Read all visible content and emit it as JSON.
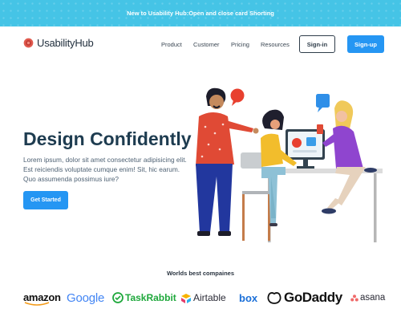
{
  "announcement": {
    "text": "New to Usability Hub:Open and close card Shorting"
  },
  "nav": {
    "brand": "UsabilityHub",
    "links": [
      "Product",
      "Customer",
      "Pricing",
      "Resources"
    ],
    "signin_label": "Sign-in",
    "signup_label": "Sign-up"
  },
  "hero": {
    "title": "Design Confidently",
    "body": "Lorem ipsum, dolor sit amet consectetur adipisicing elit. Est reiciendis voluptate cumque enim! Sit, hic earum. Quo assumenda possimus iure?",
    "cta_label": "Get Started"
  },
  "partners": {
    "heading": "Worlds best compaines",
    "logos": [
      "amazon",
      "Google",
      "TaskRabbit",
      "Airtable",
      "box",
      "GoDaddy",
      "asana"
    ]
  },
  "colors": {
    "announcement_bg": "#45c4e6",
    "primary": "#2596f3",
    "heading": "#1e3c50"
  },
  "icons": {
    "brand_mark": "usabilityhub-logo-icon",
    "illustration": "team-design-illustration"
  }
}
